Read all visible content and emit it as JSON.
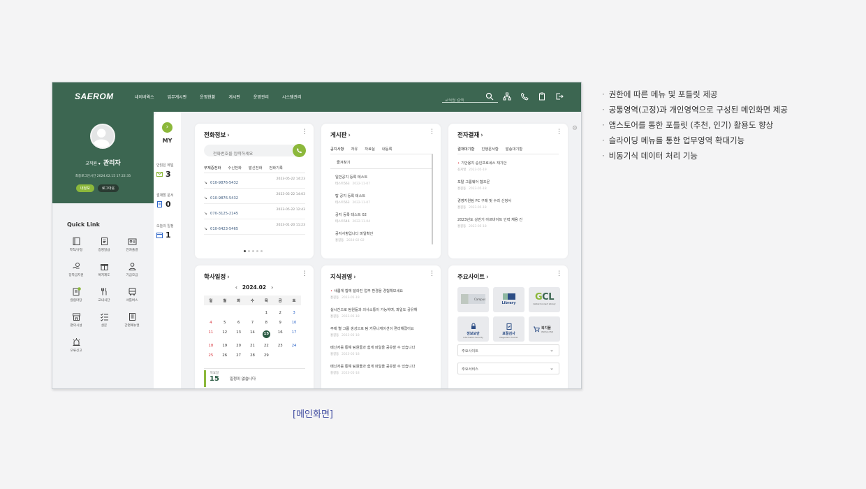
{
  "app": {
    "logo": "SAEROM",
    "nav": [
      "네이버웍스",
      "업무게시판",
      "운영현황",
      "게시판",
      "운영관리",
      "시스템관리"
    ],
    "search_placeholder": "교직원 검색",
    "top_icons": [
      "search-icon",
      "org-chart-icon",
      "phone-icon",
      "clipboard-icon",
      "logout-icon"
    ]
  },
  "profile": {
    "role": "교직원 ▾",
    "name": "관리자",
    "last_login": "최종로그인시간 2024.02.15 17:22:35",
    "my_info_btn": "내정보",
    "logout_btn": "로그아웃"
  },
  "quick_link": {
    "title": "Quick Link",
    "items": [
      {
        "label": "학칙/규정",
        "icon": "book-icon"
      },
      {
        "label": "증명발급",
        "icon": "document-icon"
      },
      {
        "label": "전자출결",
        "icon": "id-card-icon"
      },
      {
        "label": "장학금지원",
        "icon": "hand-coin-icon"
      },
      {
        "label": "복지제도",
        "icon": "gift-icon"
      },
      {
        "label": "기금모금",
        "icon": "donation-icon"
      },
      {
        "label": "칼럼마당",
        "icon": "column-icon"
      },
      {
        "label": "교내식단",
        "icon": "cutlery-icon"
      },
      {
        "label": "셔틀버스",
        "icon": "bus-icon"
      },
      {
        "label": "편의시설",
        "icon": "store-icon"
      },
      {
        "label": "설문",
        "icon": "checklist-icon"
      },
      {
        "label": "간편예뉴얼",
        "icon": "manual-icon"
      },
      {
        "label": "오류신고",
        "icon": "siren-icon"
      }
    ]
  },
  "my": {
    "label": "MY",
    "stats": [
      {
        "label": "안읽은 메일",
        "value": "3",
        "icon": "mail-icon"
      },
      {
        "label": "결재할 문서",
        "value": "0",
        "icon": "doc-icon"
      },
      {
        "label": "오늘의 일정",
        "value": "1",
        "icon": "calendar-icon"
      }
    ]
  },
  "phone": {
    "title": "전화정보",
    "placeholder": "전화번호를 입력하세요",
    "tabs": [
      "부재중전화",
      "수신전화",
      "발신전화",
      "전화기록"
    ],
    "rows": [
      {
        "number": "010-9876-5432",
        "time": "2023-05-22 14:23"
      },
      {
        "number": "010-9876-5432",
        "time": "2023-05-22 14:03"
      },
      {
        "number": "070-3125-2145",
        "time": "2023-05-22 12:43"
      },
      {
        "number": "010-6423-5465",
        "time": "2023-01-20 11:23"
      }
    ],
    "page_count": 5
  },
  "board": {
    "title": "게시판",
    "tabs": [
      "공지사항",
      "자유",
      "자료실",
      "내등록",
      "즐겨찾기"
    ],
    "rows": [
      {
        "title": "일반공지 등록 테스트",
        "meta": "테스트563",
        "date": "2022-11-07"
      },
      {
        "title": "탑 공지 등록 테스트",
        "meta": "테스트563",
        "date": "2022-11-07"
      },
      {
        "title": "공지 등록 테스트 02",
        "meta": "테스트546",
        "date": "2022-11-04"
      },
      {
        "title": "공지사항입니다 파일확인",
        "meta": "홍길동",
        "date": "2024-02-02"
      }
    ]
  },
  "approval": {
    "title": "전자결재",
    "tabs": [
      "결재대기함",
      "진행문서함",
      "발송대기함"
    ],
    "rows": [
      {
        "title": "기안용지 승인프로세스 재기안",
        "meta": "김지영",
        "date": "2023-05-19"
      },
      {
        "title": "포탈 그룹웨어 협조문",
        "meta": "홍길동",
        "date": "2023-05-18"
      },
      {
        "title": "경영지원팀 PC 구매 및 수리 신청서",
        "meta": "홍길동",
        "date": "2023-05-18"
      },
      {
        "title": "2023년도 상반기 아르바이트 인력 채용 건",
        "meta": "홍길동",
        "date": "2023-05-18"
      }
    ]
  },
  "schedule": {
    "title": "학사일정",
    "month": "2024.02",
    "weekdays": [
      "일",
      "월",
      "화",
      "수",
      "목",
      "금",
      "토"
    ],
    "weeks": [
      [
        "",
        "",
        "",
        "",
        "1",
        "2",
        "3"
      ],
      [
        "4",
        "5",
        "6",
        "7",
        "8",
        "9",
        "10"
      ],
      [
        "11",
        "12",
        "13",
        "14",
        "15",
        "16",
        "17"
      ],
      [
        "18",
        "19",
        "20",
        "21",
        "22",
        "23",
        "24"
      ],
      [
        "25",
        "26",
        "27",
        "28",
        "29",
        "",
        ""
      ]
    ],
    "today": "15",
    "today_day": "목요일",
    "today_num": "15",
    "empty_msg": "일정이 없습니다"
  },
  "knowledge": {
    "title": "지식경영",
    "rows": [
      {
        "title": "새롭게 함께 달라진 업무 환경을 경험해보세요",
        "meta": "홍길동",
        "date": "2023-05-19"
      },
      {
        "title": "실시간으로 팀원들과 의사소통이 가능하며, 파일도 공유해",
        "meta": "홍길동",
        "date": "2023-05-18"
      },
      {
        "title": "주제 별 그룹 생성으로 팀 커뮤니케이션이 편리해졌어요",
        "meta": "홍길동",
        "date": "2023-05-18"
      },
      {
        "title": "메신저를 통해 팀원들과 쉽게 파일을 공유할 수 있습니다",
        "meta": "홍길동",
        "date": "2023-05-18"
      },
      {
        "title": "메신저를 통해 팀원들과 쉽게 파일을 공유할 수 있습니다",
        "meta": "홍길동",
        "date": "2023-05-18"
      }
    ]
  },
  "sites": {
    "title": "주요사이트",
    "logos": [
      {
        "label": "Campus",
        "sub": ""
      },
      {
        "label": "Library",
        "sub": ""
      },
      {
        "label": "GCL",
        "sub": "Global Connect Library"
      },
      {
        "label": "정보보안",
        "sub": "Information Security"
      },
      {
        "label": "표절검사",
        "sub": "Plagiarism checker"
      },
      {
        "label": "복지몰",
        "sub": "Welfare Mall"
      }
    ],
    "select1": "주요사이트",
    "select2": "주요서비스"
  },
  "description": [
    "권한에 따른 메뉴 및 포틀릿 제공",
    "공통영역(고정)과 개인영역으로 구성된 메인화면 제공",
    "앱스토어를 통한 포틀릿 (추천, 인기) 활용도 향상",
    "슬라이딩 메뉴를 통한 업무영역 확대기능",
    "비동기식 데이터 처리 기능"
  ],
  "caption": "[메인화면]",
  "colors": {
    "brand_green": "#3c6651",
    "accent_lime": "#8cb83b",
    "sunday": "#d8333b",
    "saturday": "#2b64c8"
  }
}
